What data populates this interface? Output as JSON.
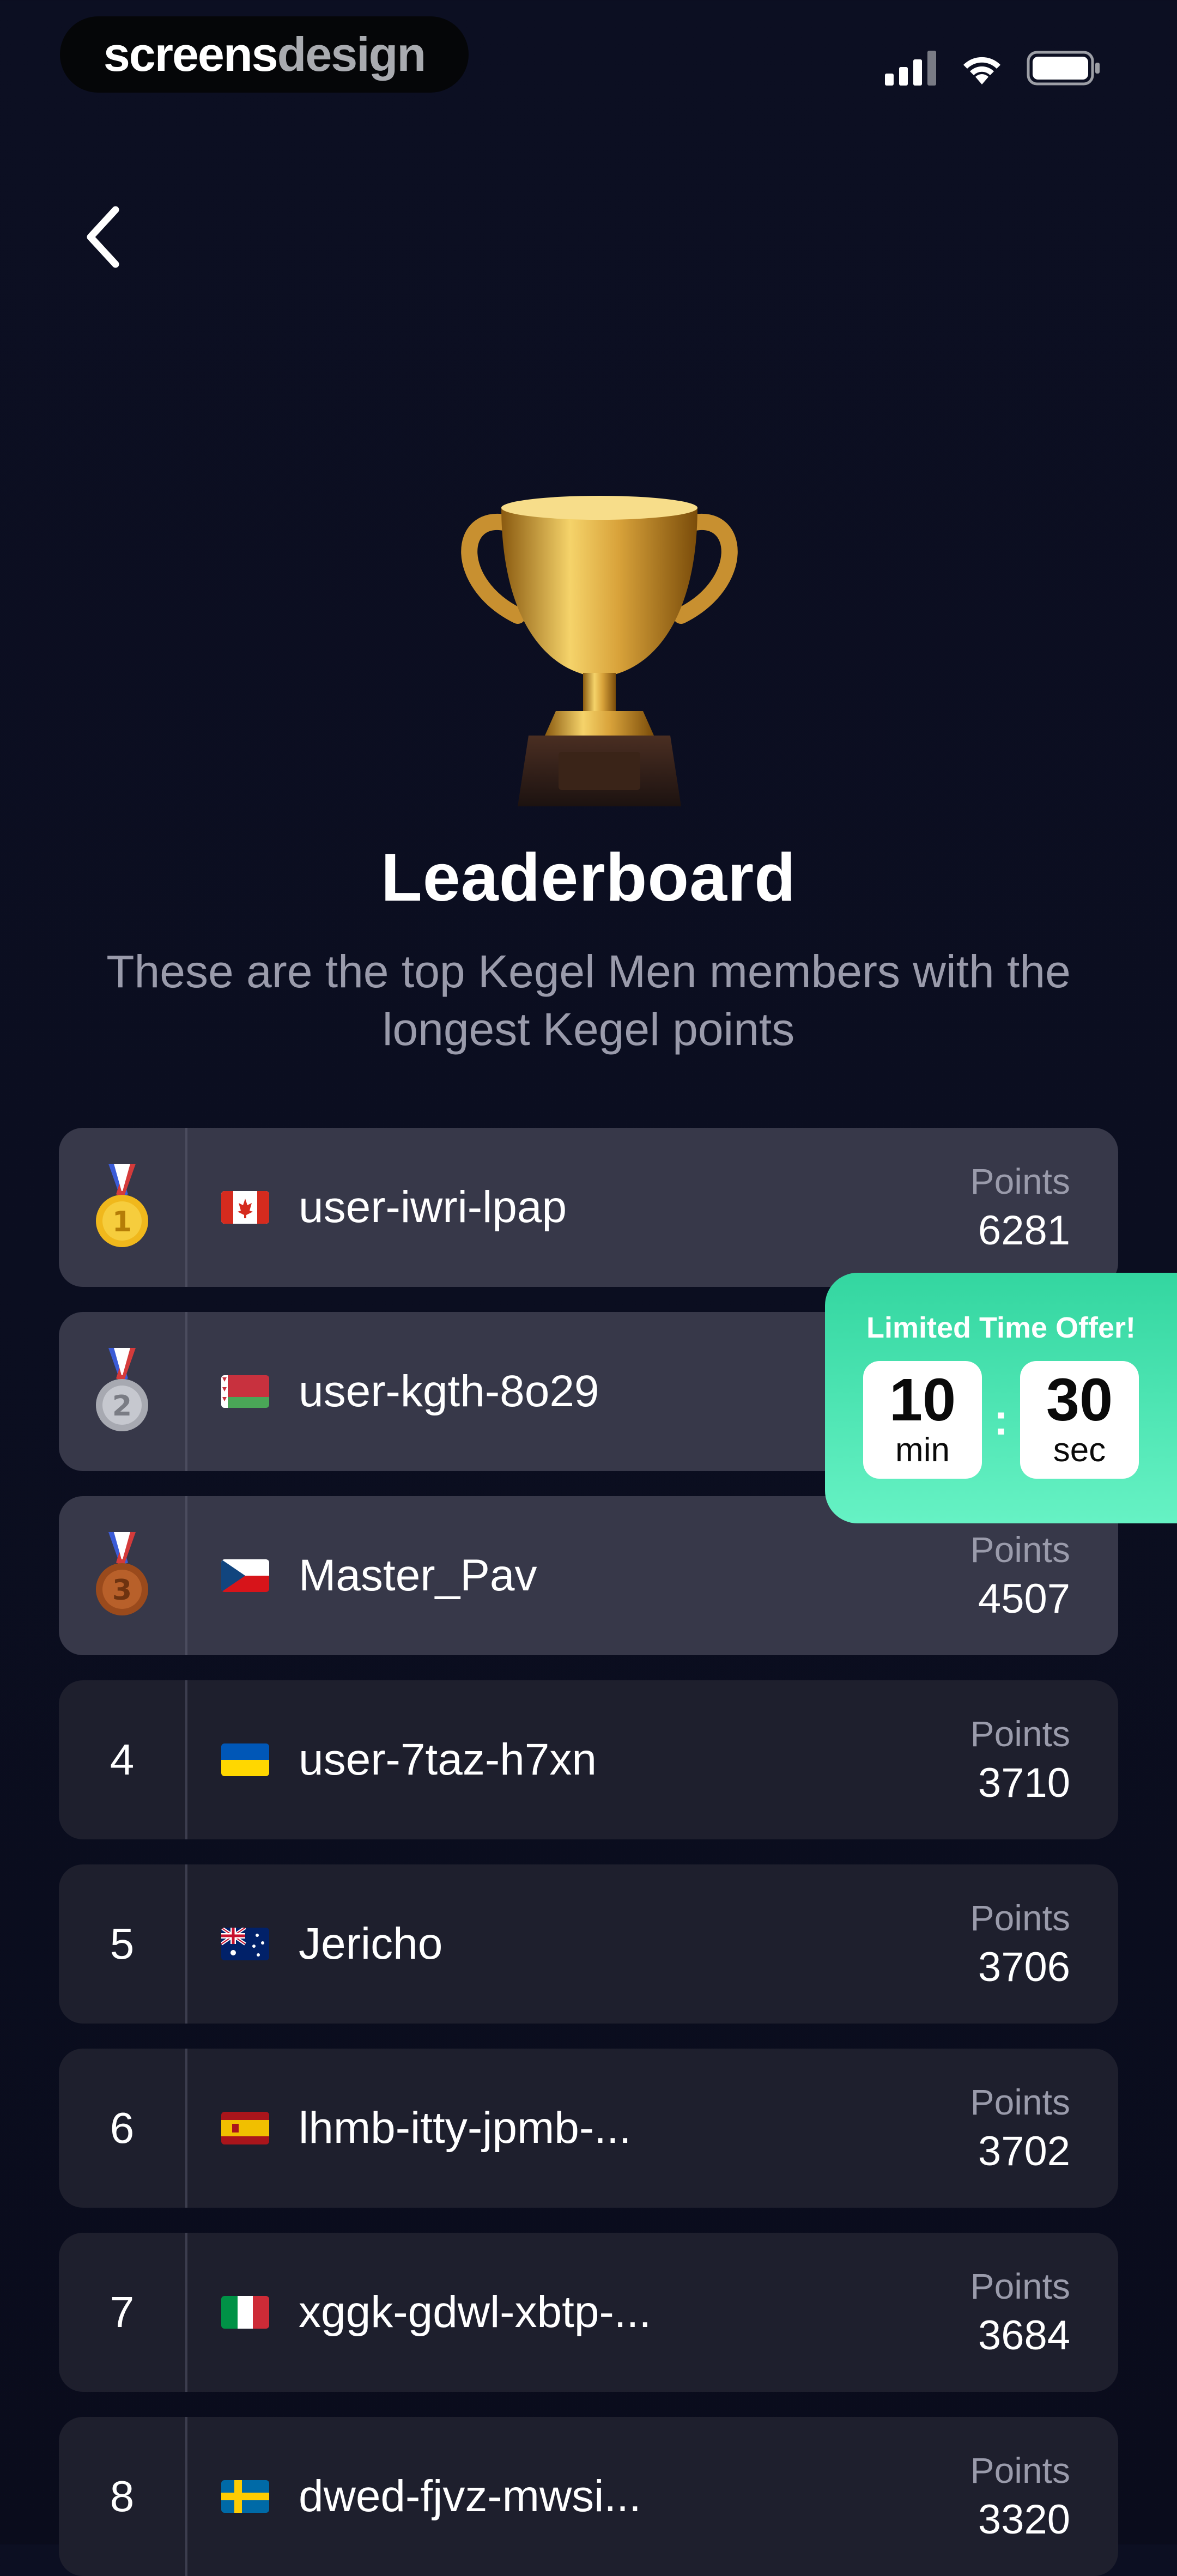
{
  "status_bar": {
    "brand_part1": "screens",
    "brand_part2": "design"
  },
  "header": {
    "title": "Leaderboard",
    "subtitle": "These are the top Kegel Men members with the longest Kegel points"
  },
  "leaderboard": {
    "points_label": "Points",
    "rows": [
      {
        "rank": "1",
        "medal": "gold-medal-icon",
        "flag": "canada-flag-icon",
        "name": "user-iwri-lpap",
        "points": "6281"
      },
      {
        "rank": "2",
        "medal": "silver-medal-icon",
        "flag": "belarus-flag-icon",
        "name": "user-kgth-8o29",
        "points": ""
      },
      {
        "rank": "3",
        "medal": "bronze-medal-icon",
        "flag": "czech-flag-icon",
        "name": "Master_Pav",
        "points": "4507"
      },
      {
        "rank": "4",
        "flag": "ukraine-flag-icon",
        "name": "user-7taz-h7xn",
        "points": "3710"
      },
      {
        "rank": "5",
        "flag": "australia-flag-icon",
        "name": "Jericho",
        "points": "3706"
      },
      {
        "rank": "6",
        "flag": "spain-flag-icon",
        "name": "lhmb-itty-jpmb-...",
        "points": "3702"
      },
      {
        "rank": "7",
        "flag": "italy-flag-icon",
        "name": "xggk-gdwl-xbtp-...",
        "points": "3684"
      },
      {
        "rank": "8",
        "flag": "sweden-flag-icon",
        "name": "dwed-fjvz-mwsi...",
        "points": "3320"
      }
    ]
  },
  "offer": {
    "title": "Limited Time Offer!",
    "minutes": "10",
    "minutes_label": "min",
    "seconds": "30",
    "seconds_label": "sec",
    "colors": {
      "start": "#33d6a0",
      "end": "#66f2c4"
    }
  }
}
